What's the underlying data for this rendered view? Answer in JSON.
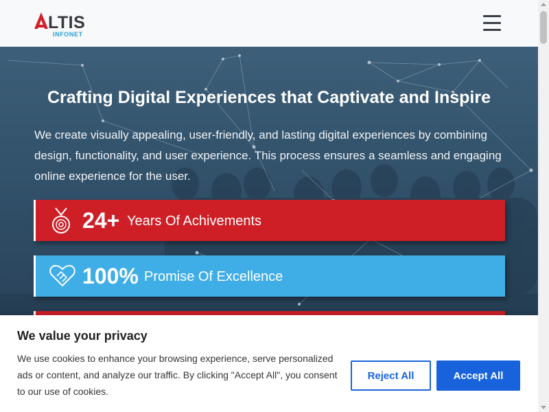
{
  "header": {
    "logo_text": "LTIS",
    "logo_sub": "INFONET",
    "menu_icon": "hamburger-icon"
  },
  "hero": {
    "title": "Crafting Digital Experiences that Captivate and Inspire",
    "description": "We create visually appealing, user-friendly, and lasting digital experiences by combining design, functionality, and user experience. This process ensures a seamless and engaging online experience for the user."
  },
  "stats": [
    {
      "number": "24+",
      "label": "Years Of Achivements",
      "icon": "medal-icon",
      "color": "#ce1f27"
    },
    {
      "number": "100%",
      "label": "Promise Of Excellence",
      "icon": "handshake-heart-icon",
      "color": "#40aee6"
    }
  ],
  "cookie": {
    "title": "We value your privacy",
    "text": "We use cookies to enhance your browsing experience, serve personalized ads or content, and analyze our traffic. By clicking \"Accept All\", you consent to our use of cookies.",
    "reject_label": "Reject All",
    "accept_label": "Accept All",
    "accent": "#1863dc"
  }
}
